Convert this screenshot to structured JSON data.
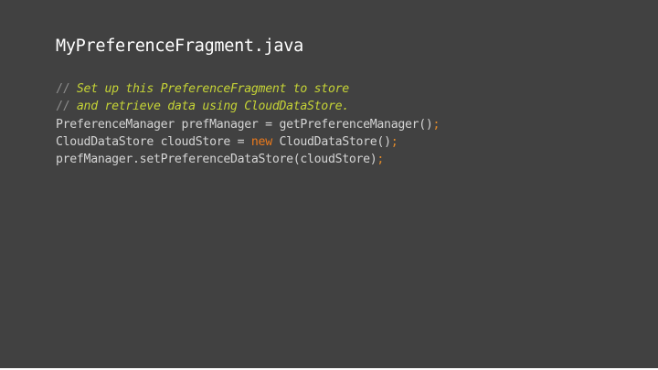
{
  "slide": {
    "title": "MyPreferenceFragment.java",
    "code_lines": [
      [
        {
          "type": "comment-marker",
          "text": "// "
        },
        {
          "type": "comment",
          "text": "Set up this PreferenceFragment to store"
        }
      ],
      [
        {
          "type": "comment-marker",
          "text": "// "
        },
        {
          "type": "comment",
          "text": "and retrieve data using CloudDataStore."
        }
      ],
      [
        {
          "type": "plain",
          "text": "PreferenceManager prefManager = getPreferenceManager()"
        },
        {
          "type": "punct",
          "text": ";"
        }
      ],
      [
        {
          "type": "plain",
          "text": "CloudDataStore cloudStore = "
        },
        {
          "type": "keyword",
          "text": "new"
        },
        {
          "type": "plain",
          "text": " CloudDataStore()"
        },
        {
          "type": "punct",
          "text": ";"
        }
      ],
      [
        {
          "type": "plain",
          "text": "prefManager.setPreferenceDataStore(cloudStore)"
        },
        {
          "type": "punct",
          "text": ";"
        }
      ]
    ]
  },
  "colors": {
    "background": "#414141",
    "title": "#ffffff",
    "code": "#d4d4d4",
    "comment": "#c5d336",
    "comment_marker": "#8d8d8d",
    "keyword": "#eb7a1c",
    "punctuation": "#e18a2a"
  }
}
